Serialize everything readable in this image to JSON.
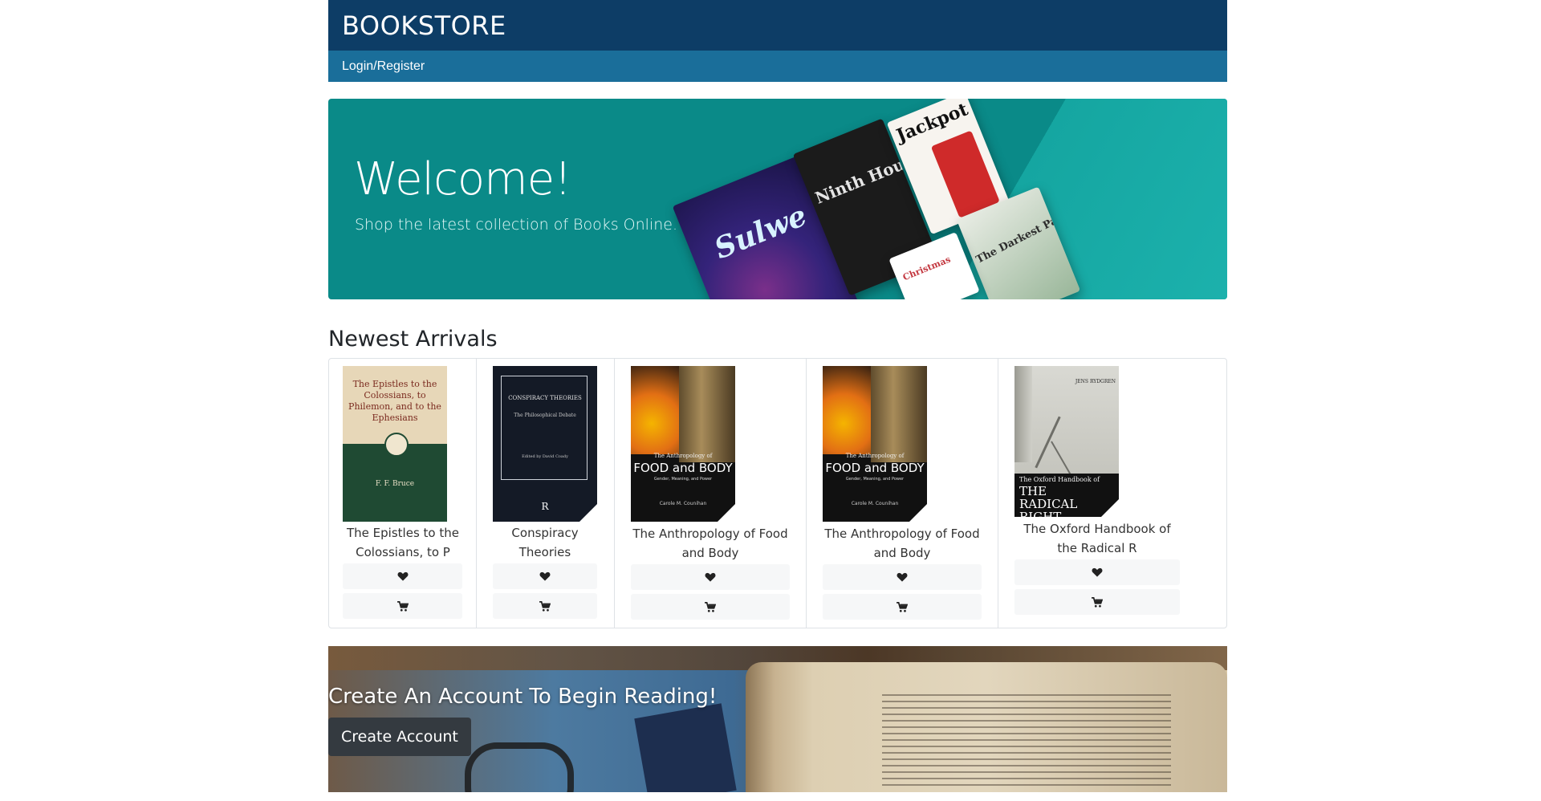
{
  "header": {
    "brand": "BOOKSTORE",
    "nav_link": "Login/Register"
  },
  "hero": {
    "title": "Welcome!",
    "subtitle": "Shop the latest collection of Books Online.",
    "books": [
      "Sulwe",
      "Ninth House",
      "Jackpot",
      "The Darkest Part of the Forest",
      "Christmas"
    ]
  },
  "newest": {
    "heading": "Newest Arrivals",
    "books": [
      {
        "title": "The Epistles to the Colossians, to P",
        "cover": "epistles"
      },
      {
        "title": "Conspiracy Theories",
        "cover": "conspiracy"
      },
      {
        "title": "The Anthropology of Food and Body",
        "cover": "anthropology"
      },
      {
        "title": "The Anthropology of Food and Body",
        "cover": "anthropology"
      },
      {
        "title": "The Oxford Handbook of the Radical R",
        "cover": "oxford"
      }
    ],
    "like_icon": "heart-icon",
    "cart_icon": "cart-icon"
  },
  "banner": {
    "heading": "Create An Account To Begin Reading!",
    "button": "Create Account"
  },
  "covers": {
    "epistles": {
      "top_text": "The Epistles to the Colossians, to Philemon, and to the Ephesians",
      "author": "F. F. Bruce"
    },
    "conspiracy": {
      "title": "CONSPIRACY THEORIES",
      "subtitle": "The Philosophical Debate",
      "editor": "Edited by David Coady",
      "mark": "R"
    },
    "anthropology": {
      "line1": "The Anthropology of",
      "line2": "FOOD and BODY",
      "line3": "Gender, Meaning, and Power",
      "author": "Carole M. Counihan"
    },
    "oxford": {
      "editor": "JENS RYDGREN",
      "line1": "The Oxford Handbook of",
      "line2": "THE RADICAL RIGHT"
    }
  }
}
